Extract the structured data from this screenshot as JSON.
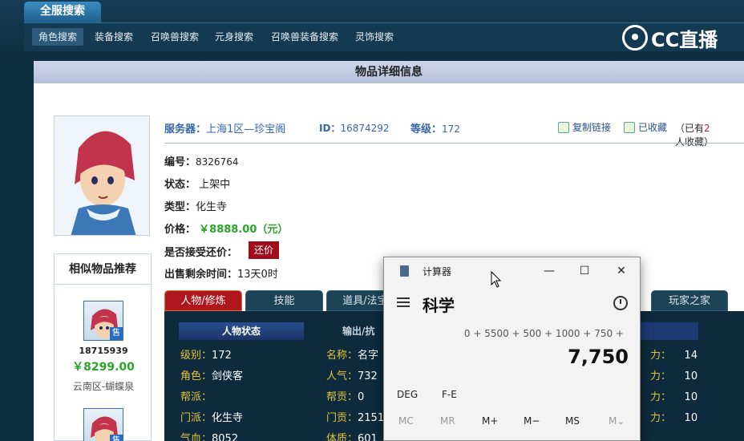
{
  "header": {
    "main_tab": "全服搜索",
    "nav": [
      "角色搜索",
      "装备搜索",
      "召唤兽搜索",
      "元身搜索",
      "召唤兽装备搜索",
      "灵饰搜索"
    ],
    "logo": "CC直播"
  },
  "panel": {
    "title": "物品详细信息",
    "server_label": "服务器：",
    "server": "上海1区—珍宝阁",
    "id_label": "ID：",
    "id": "16874292",
    "level_label": "等级：",
    "level": "172",
    "copy_link": "复制链接",
    "collected": "已收藏",
    "collect_note_pre": "（已有",
    "collect_count": "2",
    "collect_note_post": "人收藏）",
    "number_label": "编号：",
    "number": "8326764",
    "status_label": "状态：",
    "status": "上架中",
    "type_label": "类型：",
    "type": "化生寺",
    "price_label": "价格：",
    "price": "￥8888.00（元）",
    "bargain_label": "是否接受还价：",
    "bargain_button": "还价",
    "remaining_label": "出售剩余时间：",
    "remaining": "13天0时"
  },
  "similar": {
    "title": "相似物品推荐",
    "tag": "售",
    "items": [
      {
        "id": "18715939",
        "price": "￥8299.00",
        "server": "云南区-蝴蝶泉"
      }
    ]
  },
  "tabs": [
    "人物/修炼",
    "技能",
    "道具/法宝",
    "玩家之家"
  ],
  "stats": {
    "head_a": "人物状态",
    "head_b": "输出/抗",
    "left": [
      {
        "k": "级别：",
        "v": "172"
      },
      {
        "k": "角色：",
        "v": "剑侠客"
      },
      {
        "k": "帮派：",
        "v": ""
      },
      {
        "k": "门派：",
        "v": "化生寺"
      },
      {
        "k": "气血：",
        "v": "8052"
      }
    ],
    "mid": [
      {
        "k": "名称：",
        "v": "名字"
      },
      {
        "k": "人气：",
        "v": "732"
      },
      {
        "k": "帮贡：",
        "v": "0"
      },
      {
        "k": "门贡：",
        "v": "2151"
      },
      {
        "k": "体质：",
        "v": "601"
      }
    ],
    "right": [
      {
        "k": "力：",
        "v": "14"
      },
      {
        "k": "力：",
        "v": "10"
      },
      {
        "k": "力：",
        "v": "10"
      },
      {
        "k": "力：",
        "v": "10"
      }
    ]
  },
  "calculator": {
    "title": "计算器",
    "mode": "科学",
    "minimize": "—",
    "maximize": "☐",
    "close": "✕",
    "expression": "0 + 5500 + 500 + 1000 + 750 +",
    "result": "7,750",
    "opt1": "DEG",
    "opt2": "F-E",
    "mem": [
      "MC",
      "MR",
      "M+",
      "M−",
      "MS",
      "M⌄"
    ]
  }
}
